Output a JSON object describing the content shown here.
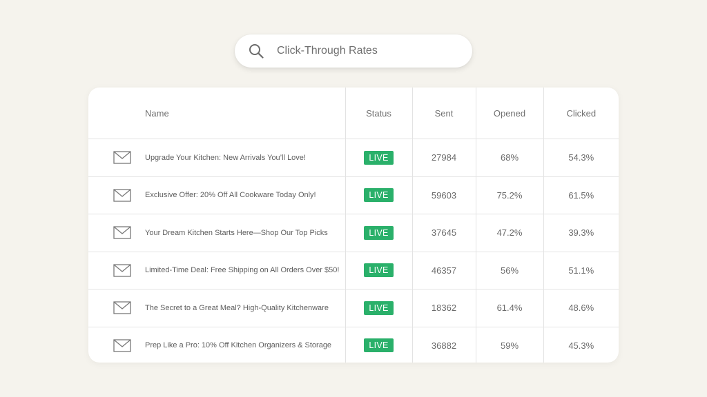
{
  "search": {
    "query": "Click-Through Rates",
    "icon": "search-icon"
  },
  "table": {
    "headers": {
      "name": "Name",
      "status": "Status",
      "sent": "Sent",
      "opened": "Opened",
      "clicked": "Clicked"
    },
    "row_icon": "envelope-icon",
    "badge_color": "#2ab06a",
    "rows": [
      {
        "name": "Upgrade Your Kitchen: New Arrivals You’ll Love!",
        "status": "LIVE",
        "sent": "27984",
        "opened": "68%",
        "clicked": "54.3%"
      },
      {
        "name": "Exclusive Offer: 20% Off All Cookware Today Only!",
        "status": "LIVE",
        "sent": "59603",
        "opened": "75.2%",
        "clicked": "61.5%"
      },
      {
        "name": "Your Dream Kitchen Starts Here—Shop Our Top Picks",
        "status": "LIVE",
        "sent": "37645",
        "opened": "47.2%",
        "clicked": "39.3%"
      },
      {
        "name": "Limited-Time Deal: Free Shipping on All Orders Over $50!",
        "status": "LIVE",
        "sent": "46357",
        "opened": "56%",
        "clicked": "51.1%"
      },
      {
        "name": "The Secret to a Great Meal? High-Quality Kitchenware",
        "status": "LIVE",
        "sent": "18362",
        "opened": "61.4%",
        "clicked": "48.6%"
      },
      {
        "name": "Prep Like a Pro: 10% Off Kitchen Organizers & Storage",
        "status": "LIVE",
        "sent": "36882",
        "opened": "59%",
        "clicked": "45.3%"
      }
    ]
  }
}
